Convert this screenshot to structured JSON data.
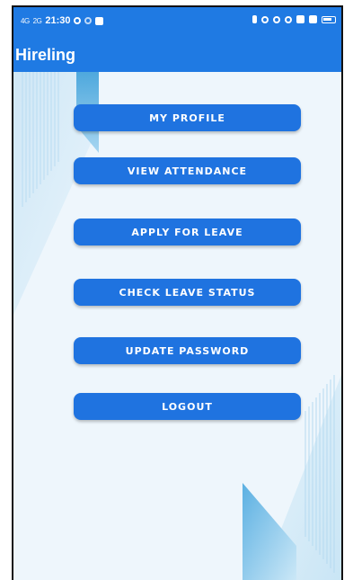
{
  "status_bar": {
    "signal_1": "4G",
    "signal_2": "2G",
    "time": "21:30"
  },
  "app_bar": {
    "title": "Hireling"
  },
  "menu": {
    "items": [
      {
        "label": "MY PROFILE"
      },
      {
        "label": "VIEW ATTENDANCE"
      },
      {
        "label": "APPLY FOR LEAVE"
      },
      {
        "label": "CHECK LEAVE STATUS"
      },
      {
        "label": "UPDATE PASSWORD"
      },
      {
        "label": "LOGOUT"
      }
    ]
  },
  "colors": {
    "primary": "#1f7ae3",
    "button": "#1f73e0",
    "background": "#eef6fc"
  }
}
